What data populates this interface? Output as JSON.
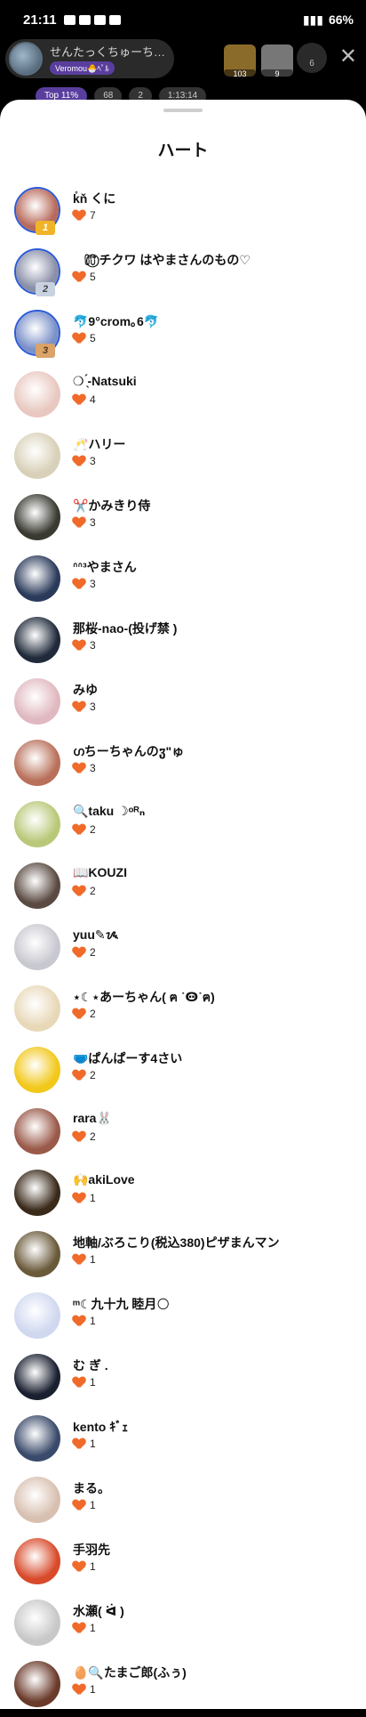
{
  "status_bar": {
    "time": "21:11",
    "battery": "66%"
  },
  "header": {
    "host_name": "せんたっくちゅーち…",
    "host_sub": "Veromou🐣ﾍﾟﾙ",
    "viewer_a_count": "103",
    "viewer_b_count": "9",
    "viewer_total": "6",
    "tabs": [
      "Top 11%",
      "68",
      "2",
      "1:13:14"
    ]
  },
  "sheet": {
    "title": "ハート",
    "heart_icon": "heart-icon",
    "heart_color": "#f06a2a",
    "items": [
      {
        "name": "k̊ň くに",
        "count": "7",
        "rank": "1",
        "color": "#b86a5a"
      },
      {
        "name": "ﾠ⩇⩇⃝⃜ チクワ はやまさんのもの♡",
        "count": "5",
        "rank": "2",
        "color": "#8a8fa8"
      },
      {
        "name": "🐬9°crom｡6🐬",
        "count": "5",
        "rank": "3",
        "color": "#7a90c8"
      },
      {
        "name": "❍ ̖́-Natsuki",
        "count": "4",
        "rank": "",
        "color": "#e8c8c0"
      },
      {
        "name": "🥂ハリー",
        "count": "3",
        "rank": "",
        "color": "#d8d0b8"
      },
      {
        "name": "✂️かみきり侍",
        "count": "3",
        "rank": "",
        "color": "#3a3a32"
      },
      {
        "name": "ᐢᐢ³やまさん",
        "count": "3",
        "rank": "",
        "color": "#2a3a5a"
      },
      {
        "name": "那桜-nao-(投げ禁 )",
        "count": "3",
        "rank": "",
        "color": "#202a3a"
      },
      {
        "name": "みゆ",
        "count": "3",
        "rank": "",
        "color": "#e0b8c0"
      },
      {
        "name": "ഗちーちゃんのჳ\"ゅ",
        "count": "3",
        "rank": "",
        "color": "#b8705a"
      },
      {
        "name": "🔍taku ☽ᵒᴿₙ",
        "count": "2",
        "rank": "",
        "color": "#b8c878"
      },
      {
        "name": "📖KOUZI",
        "count": "2",
        "rank": "",
        "color": "#5a4a42"
      },
      {
        "name": "yuu✎ᝰ",
        "count": "2",
        "rank": "",
        "color": "#c8c8d0"
      },
      {
        "name": "⋆☾⋆あーちゃん( ฅ ˙Ꙫ˙ฅ)",
        "count": "2",
        "rank": "",
        "color": "#e8d8b8"
      },
      {
        "name": "🩲ぱんぱーす4さい",
        "count": "2",
        "rank": "",
        "color": "#f2c81a"
      },
      {
        "name": "rara🐰",
        "count": "2",
        "rank": "",
        "color": "#9a5a4a"
      },
      {
        "name": "🙌akiLove",
        "count": "1",
        "rank": "",
        "color": "#3a2a1a"
      },
      {
        "name": "地軸/ぶろこり(税込380)ピザまんマン",
        "count": "1",
        "rank": "",
        "color": "#6a5a3a"
      },
      {
        "name": "ᵐ☾九十九 睦月🌕",
        "count": "1",
        "rank": "",
        "color": "#d0d8f0"
      },
      {
        "name": "む ぎ .",
        "count": "1",
        "rank": "",
        "color": "#1a2030"
      },
      {
        "name": "kento ｷﾞｪ",
        "count": "1",
        "rank": "",
        "color": "#3a4a6a"
      },
      {
        "name": "まる。",
        "count": "1",
        "rank": "",
        "color": "#d8c0b0"
      },
      {
        "name": "手羽先",
        "count": "1",
        "rank": "",
        "color": "#d84a2a"
      },
      {
        "name": "水瀬( ᐛ )",
        "count": "1",
        "rank": "",
        "color": "#c8c8c8"
      },
      {
        "name": "🥚🔍たまご郎(ふぅ)",
        "count": "1",
        "rank": "",
        "color": "#6a3a2a"
      }
    ]
  }
}
